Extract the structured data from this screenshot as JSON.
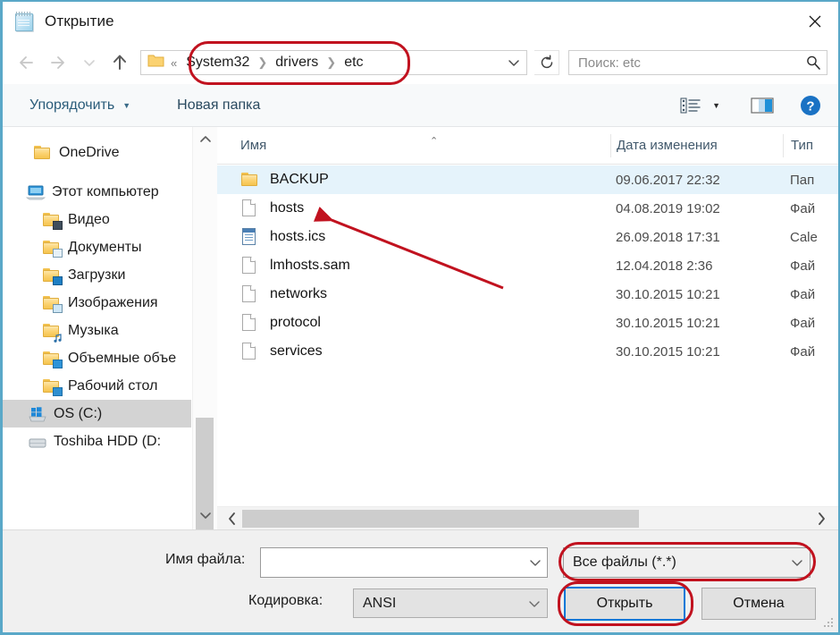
{
  "window": {
    "title": "Открытие",
    "app_icon": "notepad-icon",
    "close_label": "✕"
  },
  "nav": {
    "back_icon": "arrow-left-icon",
    "forward_icon": "arrow-right-icon",
    "recent_icon": "chevron-down-icon",
    "up_icon": "arrow-up-icon",
    "folder_icon": "folder-icon",
    "overflow": "«",
    "crumbs": [
      "System32",
      "drivers",
      "etc"
    ],
    "separator": "❯",
    "dropdown_icon": "chevron-down-icon",
    "refresh_icon": "refresh-icon"
  },
  "search": {
    "value": "Поиск: etc",
    "placeholder": "Поиск: etc",
    "icon": "search-icon"
  },
  "commandbar": {
    "organize_label": "Упорядочить",
    "organize_caret": "▼",
    "new_folder_label": "Новая папка",
    "view_icon": "view-list-icon",
    "view_caret": "▼",
    "preview_pane_icon": "preview-pane-icon",
    "help_icon": "help-icon"
  },
  "sidebar": {
    "items": [
      {
        "label": "OneDrive",
        "icon": "folder-icon",
        "indent": "indent-0",
        "selected": false
      },
      {
        "label": "Этот компьютер",
        "icon": "this-pc-icon",
        "indent": "indent-1",
        "selected": false
      },
      {
        "label": "Видео",
        "icon": "videos-folder-icon",
        "indent": "indent-2",
        "selected": false
      },
      {
        "label": "Документы",
        "icon": "documents-folder-icon",
        "indent": "indent-2",
        "selected": false
      },
      {
        "label": "Загрузки",
        "icon": "downloads-folder-icon",
        "indent": "indent-2",
        "selected": false
      },
      {
        "label": "Изображения",
        "icon": "pictures-folder-icon",
        "indent": "indent-2",
        "selected": false
      },
      {
        "label": "Музыка",
        "icon": "music-folder-icon",
        "indent": "indent-2",
        "selected": false
      },
      {
        "label": "Объемные объе",
        "icon": "3d-objects-folder-icon",
        "indent": "indent-2",
        "selected": false
      },
      {
        "label": "Рабочий стол",
        "icon": "desktop-folder-icon",
        "indent": "indent-2",
        "selected": false
      },
      {
        "label": "OS (C:)",
        "icon": "windows-drive-icon",
        "indent": "indent-3",
        "selected": true
      },
      {
        "label": "Toshiba HDD (D:",
        "icon": "hard-drive-icon",
        "indent": "indent-3",
        "selected": false
      }
    ],
    "scroll_up_icon": "chevron-up-icon",
    "scroll_down_icon": "chevron-down-icon"
  },
  "filelist": {
    "columns": [
      "Имя",
      "Дата изменения",
      "Тип"
    ],
    "sort_indicator": "⌃",
    "rows": [
      {
        "name": "BACKUP",
        "icon": "folder-icon",
        "date": "09.06.2017 22:32",
        "type": "Пап",
        "selected": true
      },
      {
        "name": "hosts",
        "icon": "document-icon",
        "date": "04.08.2019 19:02",
        "type": "Фай",
        "selected": false
      },
      {
        "name": "hosts.ics",
        "icon": "calendar-icon",
        "date": "26.09.2018 17:31",
        "type": "Cale",
        "selected": false
      },
      {
        "name": "lmhosts.sam",
        "icon": "document-icon",
        "date": "12.04.2018 2:36",
        "type": "Фай",
        "selected": false
      },
      {
        "name": "networks",
        "icon": "document-icon",
        "date": "30.10.2015 10:21",
        "type": "Фай",
        "selected": false
      },
      {
        "name": "protocol",
        "icon": "document-icon",
        "date": "30.10.2015 10:21",
        "type": "Фай",
        "selected": false
      },
      {
        "name": "services",
        "icon": "document-icon",
        "date": "30.10.2015 10:21",
        "type": "Фай",
        "selected": false
      }
    ],
    "hscroll_left_icon": "chevron-left-icon",
    "hscroll_right_icon": "chevron-right-icon"
  },
  "bottom": {
    "filename_label": "Имя файла:",
    "filename_value": "",
    "filename_caret": "⌄",
    "filter_value": "Все файлы  (*.*)",
    "filter_caret": "⌄",
    "encoding_label": "Кодировка:",
    "encoding_value": "ANSI",
    "encoding_caret": "⌄",
    "open_label": "Открыть",
    "cancel_label": "Отмена"
  },
  "annotations": {
    "color": "#c1121f",
    "highlight_address_bar": "System32 > drivers > etc",
    "highlight_filter": "Все файлы  (*.*)",
    "highlight_open_button": "Открыть",
    "arrow_points_to": "hosts"
  }
}
